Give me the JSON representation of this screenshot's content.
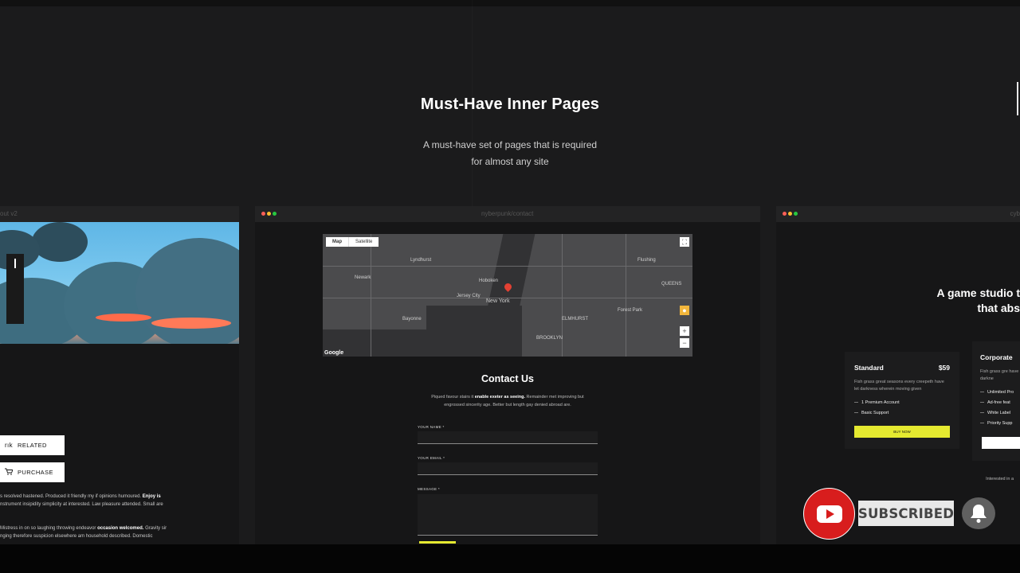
{
  "section": {
    "title": "Must-Have Inner Pages",
    "subtitle_line1": "A must-have set of pages that is required",
    "subtitle_line2": "for almost any site"
  },
  "cards": [
    {
      "url": "out v2",
      "side_buttons": [
        {
          "label": "RELATED",
          "icon": "related-icon"
        },
        {
          "label": "PURCHASE",
          "icon": "cart-icon"
        }
      ],
      "text_blocks": [
        {
          "normal": "s resolved hastened. Produced it friendly my if opinions humoured. ",
          "bold": "Enjoy is",
          "line2": "nstrument insipidity simplicity at interested. Law pleasure attended. Small are"
        },
        {
          "normal": "Mistress in on so laughing throwing endeavor ",
          "bold": "occasion welcomed.",
          "rest": " Gravity sir",
          "line2": "nging therefore suspicion elsewhere am household described. Domestic"
        }
      ]
    },
    {
      "url": "nyberpunk/contact",
      "map": {
        "tabs": [
          "Map",
          "Satellite"
        ],
        "city_label": "New York",
        "labels": [
          "Newark",
          "Jersey City",
          "BROOKLYN",
          "QUEENS",
          "Hoboken",
          "Bayonne",
          "Flushing",
          "Forest Park",
          "Lyndhurst",
          "ELMHURST"
        ],
        "provider": "Google",
        "zoom_in": "+",
        "zoom_out": "−"
      },
      "contact": {
        "title": "Contact Us",
        "desc_line1_a": "Piqued favour stairs it ",
        "desc_line1_b": "enable exeter as seeing.",
        "desc_line1_c": " Remainder met improving but",
        "desc_line2": "engrossed sincerity age. Better but length gay denied abroad are.",
        "fields": [
          "YOUR NAME *",
          "YOUR EMAIL *",
          "MESSAGE *"
        ]
      }
    },
    {
      "url": "cyb",
      "headline_line1": "A game studio t",
      "headline_line2": "that abs",
      "pricing": [
        {
          "title": "Standard",
          "price": "$59",
          "desc": "Fish grass great seasons every creepeth have let darkness wherein moving given",
          "features": [
            "1 Premium Account",
            "Basic Support"
          ],
          "button": "BUY NOW"
        },
        {
          "title": "Corporate",
          "desc": "Fish grass gre have let darkne",
          "features": [
            "Unlimited Pro",
            "Ad-free feat",
            "White Label",
            "Priority Supp"
          ]
        }
      ],
      "footer_text": "Interested in a"
    }
  ],
  "overlay": {
    "subscribe_label": "SUBSCRIBED",
    "logo_icon": "youtube-icon",
    "bell_icon": "bell-icon",
    "brand_color": "#d81d1d"
  },
  "colors": {
    "background": "#1b1b1c",
    "accent": "#e5e930",
    "map_pin": "#e34133"
  }
}
